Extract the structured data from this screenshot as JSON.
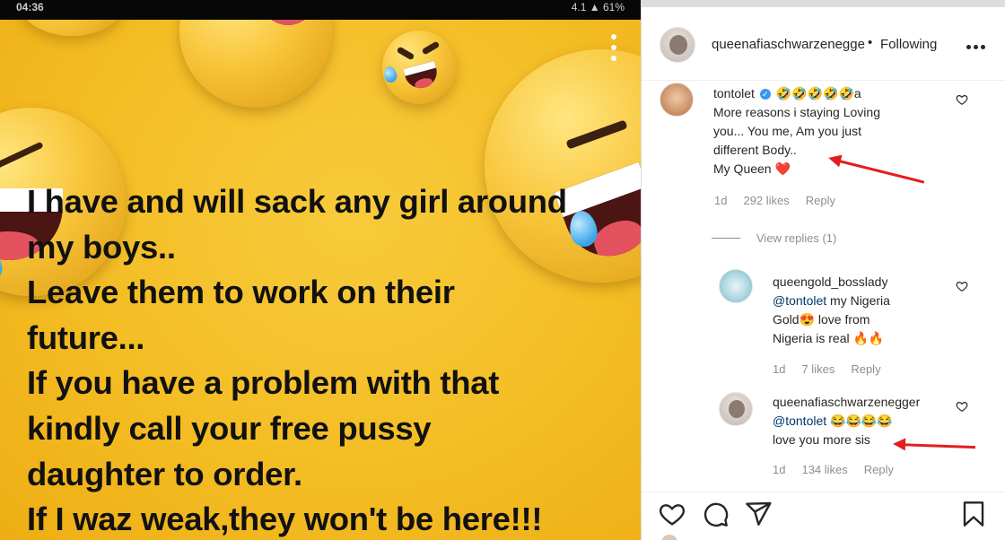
{
  "post": {
    "status_time": "04:36",
    "status_right": "4.1 ▲ 61%",
    "lines": [
      "I have and will sack any girl around",
      "my boys..",
      "Leave them to work on their",
      "future...",
      "If you have a problem with that",
      "kindly call your free pussy",
      "daughter to order.",
      "If I waz weak,they won't be here!!!"
    ]
  },
  "header": {
    "username": "queenafiaschwarzenegger",
    "separator": "•",
    "following": "Following"
  },
  "comments": [
    {
      "username": "tontolet",
      "verified_mark": "✓",
      "emojis": "🤣🤣🤣🤣🤣a",
      "text_lines": [
        "More reasons i staying Loving",
        "you... You me, Am you just",
        "different Body..",
        "My Queen ❤️"
      ],
      "age": "1d",
      "likes": "292 likes",
      "reply": "Reply"
    }
  ],
  "view_replies": "View replies (1)",
  "replies": [
    {
      "username": "queengold_bosslady",
      "mention": "@tontolet",
      "text_lines": [
        " my Nigeria",
        "Gold😍 love from",
        "Nigeria is real 🔥🔥"
      ],
      "age": "1d",
      "likes": "7 likes",
      "reply": "Reply"
    },
    {
      "username": "queenafiaschwarzenegger",
      "mention": "@tontolet",
      "emojis": " 😂😂😂😂",
      "text_lines": [
        "love you more sis"
      ],
      "age": "1d",
      "likes": "134 likes",
      "reply": "Reply"
    }
  ],
  "icons": {
    "like": "heart-icon",
    "comment": "comment-icon",
    "share": "share-icon",
    "save": "bookmark-icon"
  },
  "colors": {
    "background_yellow": "#f4bd24",
    "link_blue": "#00376b",
    "verified_blue": "#3897f0",
    "annotation_red": "#e21f1f"
  }
}
